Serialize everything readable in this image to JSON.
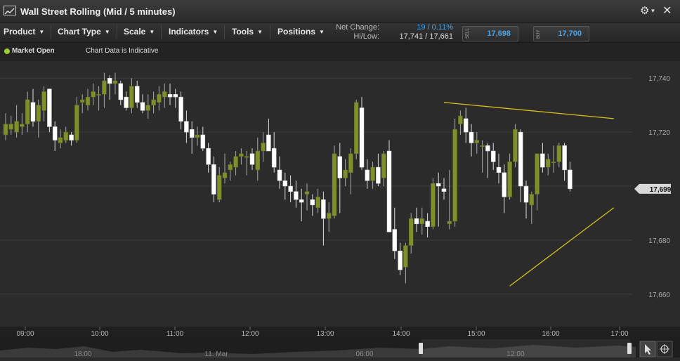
{
  "window": {
    "title": "Wall Street Rolling (Mid / 5 minutes)"
  },
  "toolbar": {
    "menus": [
      "Product",
      "Chart Type",
      "Scale",
      "Indicators",
      "Tools",
      "Positions"
    ],
    "net_change_label": "Net Change:",
    "net_change_value": "19 / 0.11%",
    "hilow_label": "Hi/Low:",
    "hilow_value": "17,741 / 17,661",
    "sell_label": "SELL",
    "sell_price": "17,698",
    "buy_label": "BUY",
    "buy_price": "17,700"
  },
  "status": {
    "market": "Market Open",
    "indicative": "Chart Data is Indicative"
  },
  "colors": {
    "up_candle": "#7e8f2c",
    "down_candle": "#ffffff",
    "trendline": "#d8c21a",
    "price_blue": "#4aa3e8",
    "market_open_dot": "#9acd32"
  },
  "navigator": {
    "labels": [
      "18:00",
      "11. Mar",
      "06:00",
      "12:00"
    ]
  },
  "chart_data": {
    "type": "candlestick",
    "title": "Wall Street Rolling (Mid / 5 minutes)",
    "interval": "5 minutes",
    "ylim": [
      17655,
      17745
    ],
    "yticks": [
      17660,
      17680,
      17700,
      17720,
      17740
    ],
    "ytick_labels": [
      "17,660",
      "17,680",
      "17,700",
      "17,720",
      "17,740"
    ],
    "xticks": [
      "09:00",
      "10:00",
      "11:00",
      "12:00",
      "13:00",
      "14:00",
      "15:00",
      "16:00",
      "17:00"
    ],
    "current_price": 17699,
    "current_price_label": "17,699",
    "grid": true,
    "candles": [
      {
        "o": 17719,
        "h": 17727,
        "l": 17717,
        "c": 17723
      },
      {
        "o": 17721,
        "h": 17726,
        "l": 17719,
        "c": 17723
      },
      {
        "o": 17720,
        "h": 17730,
        "l": 17718,
        "c": 17724
      },
      {
        "o": 17722,
        "h": 17727,
        "l": 17719,
        "c": 17723
      },
      {
        "o": 17723,
        "h": 17735,
        "l": 17720,
        "c": 17732
      },
      {
        "o": 17731,
        "h": 17736,
        "l": 17722,
        "c": 17724
      },
      {
        "o": 17724,
        "h": 17732,
        "l": 17718,
        "c": 17730
      },
      {
        "o": 17728,
        "h": 17737,
        "l": 17724,
        "c": 17735
      },
      {
        "o": 17736,
        "h": 17736,
        "l": 17720,
        "c": 17722
      },
      {
        "o": 17722,
        "h": 17724,
        "l": 17713,
        "c": 17717
      },
      {
        "o": 17716,
        "h": 17721,
        "l": 17714,
        "c": 17718
      },
      {
        "o": 17717,
        "h": 17722,
        "l": 17716,
        "c": 17720
      },
      {
        "o": 17719,
        "h": 17720,
        "l": 17715,
        "c": 17717
      },
      {
        "o": 17717,
        "h": 17733,
        "l": 17716,
        "c": 17730
      },
      {
        "o": 17731,
        "h": 17734,
        "l": 17727,
        "c": 17732
      },
      {
        "o": 17730,
        "h": 17736,
        "l": 17728,
        "c": 17733
      },
      {
        "o": 17733,
        "h": 17738,
        "l": 17730,
        "c": 17735
      },
      {
        "o": 17734,
        "h": 17737,
        "l": 17728,
        "c": 17734
      },
      {
        "o": 17734,
        "h": 17742,
        "l": 17729,
        "c": 17739
      },
      {
        "o": 17740,
        "h": 17741,
        "l": 17732,
        "c": 17738
      },
      {
        "o": 17738,
        "h": 17742,
        "l": 17734,
        "c": 17739
      },
      {
        "o": 17738,
        "h": 17739,
        "l": 17730,
        "c": 17732
      },
      {
        "o": 17733,
        "h": 17735,
        "l": 17728,
        "c": 17729
      },
      {
        "o": 17729,
        "h": 17740,
        "l": 17727,
        "c": 17737
      },
      {
        "o": 17737,
        "h": 17739,
        "l": 17729,
        "c": 17731
      },
      {
        "o": 17731,
        "h": 17734,
        "l": 17727,
        "c": 17728
      },
      {
        "o": 17728,
        "h": 17734,
        "l": 17725,
        "c": 17730
      },
      {
        "o": 17730,
        "h": 17735,
        "l": 17727,
        "c": 17732
      },
      {
        "o": 17731,
        "h": 17737,
        "l": 17728,
        "c": 17734
      },
      {
        "o": 17733,
        "h": 17738,
        "l": 17729,
        "c": 17735
      },
      {
        "o": 17734,
        "h": 17738,
        "l": 17730,
        "c": 17733
      },
      {
        "o": 17734,
        "h": 17736,
        "l": 17729,
        "c": 17733
      },
      {
        "o": 17733,
        "h": 17735,
        "l": 17721,
        "c": 17724
      },
      {
        "o": 17724,
        "h": 17728,
        "l": 17716,
        "c": 17720
      },
      {
        "o": 17721,
        "h": 17724,
        "l": 17712,
        "c": 17718
      },
      {
        "o": 17718,
        "h": 17722,
        "l": 17715,
        "c": 17719
      },
      {
        "o": 17719,
        "h": 17722,
        "l": 17713,
        "c": 17714
      },
      {
        "o": 17714,
        "h": 17716,
        "l": 17705,
        "c": 17708
      },
      {
        "o": 17708,
        "h": 17711,
        "l": 17694,
        "c": 17697
      },
      {
        "o": 17695,
        "h": 17707,
        "l": 17694,
        "c": 17704
      },
      {
        "o": 17703,
        "h": 17712,
        "l": 17701,
        "c": 17705
      },
      {
        "o": 17706,
        "h": 17709,
        "l": 17702,
        "c": 17708
      },
      {
        "o": 17707,
        "h": 17713,
        "l": 17704,
        "c": 17711
      },
      {
        "o": 17711,
        "h": 17714,
        "l": 17708,
        "c": 17712
      },
      {
        "o": 17711,
        "h": 17713,
        "l": 17704,
        "c": 17711
      },
      {
        "o": 17712,
        "h": 17714,
        "l": 17706,
        "c": 17708
      },
      {
        "o": 17706,
        "h": 17718,
        "l": 17702,
        "c": 17713
      },
      {
        "o": 17713,
        "h": 17720,
        "l": 17709,
        "c": 17716
      },
      {
        "o": 17719,
        "h": 17725,
        "l": 17713,
        "c": 17713
      },
      {
        "o": 17714,
        "h": 17720,
        "l": 17705,
        "c": 17707
      },
      {
        "o": 17706,
        "h": 17711,
        "l": 17699,
        "c": 17702
      },
      {
        "o": 17702,
        "h": 17705,
        "l": 17695,
        "c": 17700
      },
      {
        "o": 17700,
        "h": 17704,
        "l": 17694,
        "c": 17698
      },
      {
        "o": 17698,
        "h": 17702,
        "l": 17692,
        "c": 17695
      },
      {
        "o": 17695,
        "h": 17699,
        "l": 17687,
        "c": 17694
      },
      {
        "o": 17697,
        "h": 17701,
        "l": 17691,
        "c": 17698
      },
      {
        "o": 17695,
        "h": 17697,
        "l": 17689,
        "c": 17693
      },
      {
        "o": 17692,
        "h": 17699,
        "l": 17690,
        "c": 17696
      },
      {
        "o": 17695,
        "h": 17698,
        "l": 17678,
        "c": 17688
      },
      {
        "o": 17688,
        "h": 17694,
        "l": 17683,
        "c": 17690
      },
      {
        "o": 17689,
        "h": 17715,
        "l": 17688,
        "c": 17712
      },
      {
        "o": 17711,
        "h": 17716,
        "l": 17690,
        "c": 17703
      },
      {
        "o": 17703,
        "h": 17710,
        "l": 17700,
        "c": 17706
      },
      {
        "o": 17705,
        "h": 17714,
        "l": 17697,
        "c": 17712
      },
      {
        "o": 17712,
        "h": 17732,
        "l": 17710,
        "c": 17731
      },
      {
        "o": 17729,
        "h": 17733,
        "l": 17706,
        "c": 17707
      },
      {
        "o": 17706,
        "h": 17710,
        "l": 17699,
        "c": 17702
      },
      {
        "o": 17702,
        "h": 17709,
        "l": 17699,
        "c": 17707
      },
      {
        "o": 17707,
        "h": 17712,
        "l": 17700,
        "c": 17701
      },
      {
        "o": 17703,
        "h": 17713,
        "l": 17700,
        "c": 17712
      },
      {
        "o": 17713,
        "h": 17717,
        "l": 17695,
        "c": 17683
      },
      {
        "o": 17684,
        "h": 17692,
        "l": 17673,
        "c": 17676
      },
      {
        "o": 17676,
        "h": 17679,
        "l": 17667,
        "c": 17669
      },
      {
        "o": 17670,
        "h": 17679,
        "l": 17664,
        "c": 17678
      },
      {
        "o": 17678,
        "h": 17690,
        "l": 17675,
        "c": 17688
      },
      {
        "o": 17688,
        "h": 17692,
        "l": 17683,
        "c": 17686
      },
      {
        "o": 17686,
        "h": 17692,
        "l": 17682,
        "c": 17688
      },
      {
        "o": 17687,
        "h": 17690,
        "l": 17681,
        "c": 17685
      },
      {
        "o": 17685,
        "h": 17703,
        "l": 17684,
        "c": 17701
      },
      {
        "o": 17701,
        "h": 17705,
        "l": 17685,
        "c": 17700
      },
      {
        "o": 17699,
        "h": 17703,
        "l": 17695,
        "c": 17698
      },
      {
        "o": 17686,
        "h": 17706,
        "l": 17684,
        "c": 17687
      },
      {
        "o": 17687,
        "h": 17725,
        "l": 17685,
        "c": 17721
      },
      {
        "o": 17723,
        "h": 17728,
        "l": 17719,
        "c": 17726
      },
      {
        "o": 17725,
        "h": 17729,
        "l": 17716,
        "c": 17720
      },
      {
        "o": 17720,
        "h": 17723,
        "l": 17711,
        "c": 17716
      },
      {
        "o": 17716,
        "h": 17720,
        "l": 17712,
        "c": 17717
      },
      {
        "o": 17715,
        "h": 17717,
        "l": 17705,
        "c": 17715
      },
      {
        "o": 17715,
        "h": 17716,
        "l": 17703,
        "c": 17713
      },
      {
        "o": 17713,
        "h": 17716,
        "l": 17706,
        "c": 17709
      },
      {
        "o": 17707,
        "h": 17712,
        "l": 17701,
        "c": 17705
      },
      {
        "o": 17705,
        "h": 17708,
        "l": 17690,
        "c": 17696
      },
      {
        "o": 17696,
        "h": 17712,
        "l": 17695,
        "c": 17709
      },
      {
        "o": 17709,
        "h": 17723,
        "l": 17707,
        "c": 17721
      },
      {
        "o": 17720,
        "h": 17721,
        "l": 17694,
        "c": 17700
      },
      {
        "o": 17700,
        "h": 17702,
        "l": 17688,
        "c": 17694
      },
      {
        "o": 17693,
        "h": 17698,
        "l": 17686,
        "c": 17697
      },
      {
        "o": 17697,
        "h": 17712,
        "l": 17691,
        "c": 17712
      },
      {
        "o": 17712,
        "h": 17716,
        "l": 17705,
        "c": 17707
      },
      {
        "o": 17707,
        "h": 17712,
        "l": 17704,
        "c": 17710
      },
      {
        "o": 17709,
        "h": 17715,
        "l": 17705,
        "c": 17709
      },
      {
        "o": 17709,
        "h": 17716,
        "l": 17707,
        "c": 17715
      },
      {
        "o": 17715,
        "h": 17716,
        "l": 17702,
        "c": 17706
      },
      {
        "o": 17706,
        "h": 17709,
        "l": 17698,
        "c": 17699
      }
    ],
    "trendlines": [
      {
        "from": {
          "i": 80,
          "p": 17731
        },
        "to": {
          "i": 111,
          "p": 17725
        }
      },
      {
        "from": {
          "i": 92,
          "p": 17663
        },
        "to": {
          "i": 111,
          "p": 17692
        }
      }
    ]
  }
}
